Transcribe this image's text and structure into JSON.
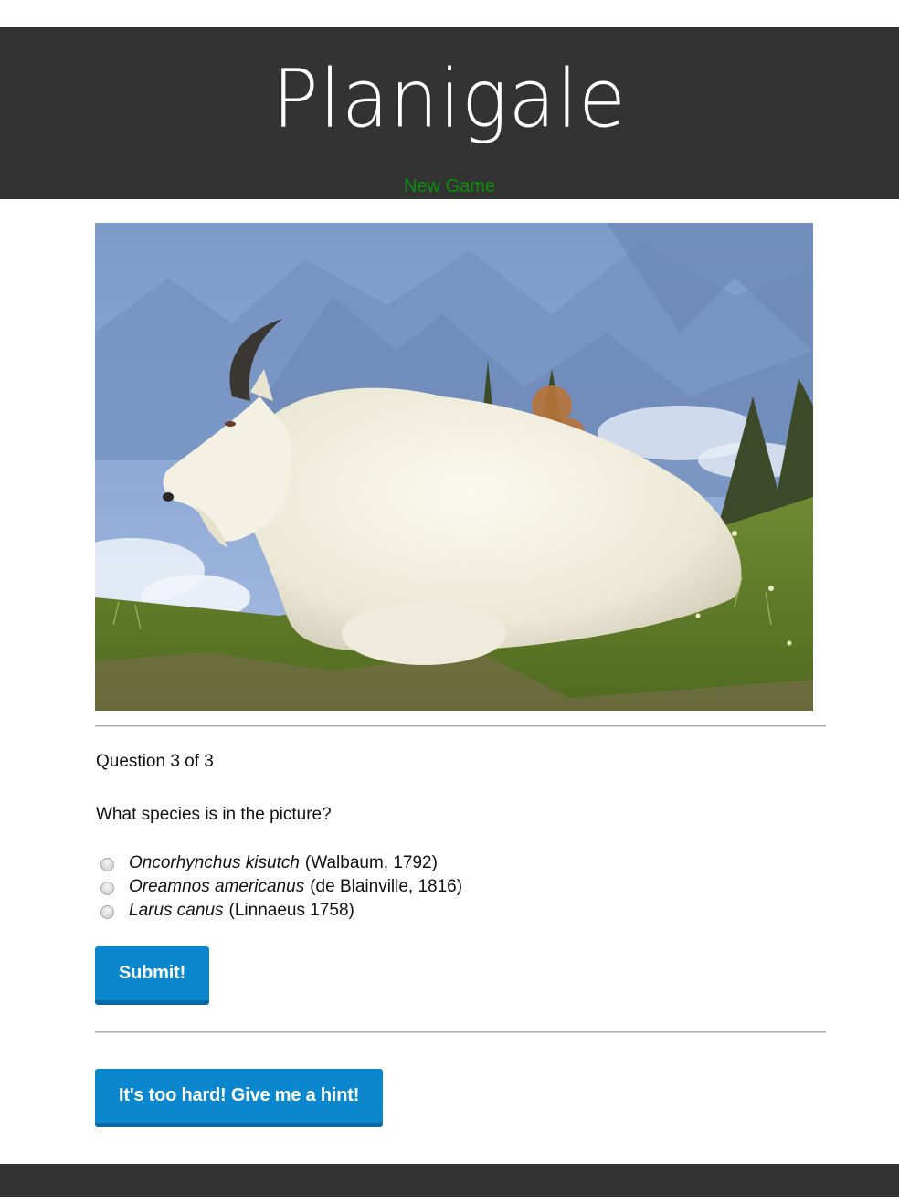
{
  "header": {
    "title": "Planigale",
    "new_game_label": "New Game"
  },
  "photo": {
    "subject": "mountain goat resting on grassy hillside"
  },
  "quiz": {
    "progress": "Question 3 of 3",
    "question": "What species is in the picture?",
    "options": [
      {
        "species": "Oncorhynchus kisutch",
        "authority": "(Walbaum, 1792)",
        "selected": false
      },
      {
        "species": "Oreamnos americanus",
        "authority": "(de Blainville, 1816)",
        "selected": false
      },
      {
        "species": "Larus canus",
        "authority": "(Linnaeus 1758)",
        "selected": false
      }
    ],
    "submit_label": "Submit!",
    "hint_label": "It's too hard! Give me a hint!"
  },
  "colors": {
    "header_bg": "#333333",
    "link": "#0a8f0a",
    "button": "#0a87cd",
    "button_shadow": "#076aa3"
  }
}
